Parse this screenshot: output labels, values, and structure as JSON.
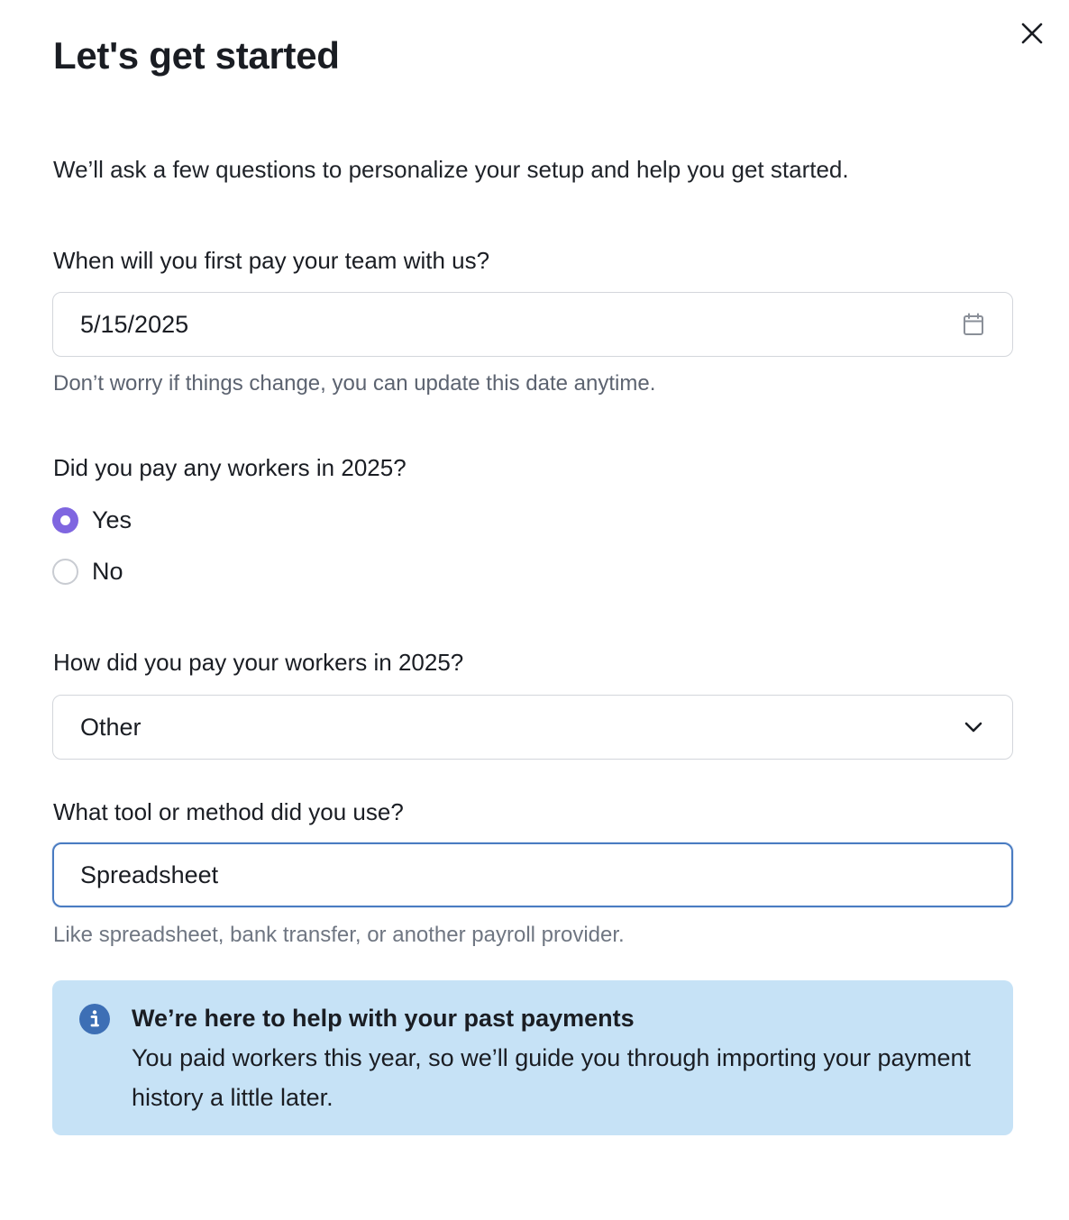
{
  "dialog": {
    "title": "Let's get started",
    "intro": "We’ll ask a few questions to personalize your setup and help you get started.",
    "close_icon": "close-icon"
  },
  "first_pay_date": {
    "label": "When will you first pay your team with us?",
    "value": "5/15/2025",
    "icon": "calendar-icon",
    "hint": "Don’t worry if things change, you can update this date anytime."
  },
  "paid_workers": {
    "label": "Did you pay any workers in 2025?",
    "options": [
      {
        "label": "Yes",
        "checked": true
      },
      {
        "label": "No",
        "checked": false
      }
    ]
  },
  "pay_method": {
    "label": "How did you pay your workers in 2025?",
    "selected": "Other",
    "icon": "chevron-down-icon"
  },
  "tool_method": {
    "label": "What tool or method did you use?",
    "value": "Spreadsheet",
    "hint": "Like spreadsheet, bank transfer, or another payroll provider."
  },
  "info_alert": {
    "icon": "info-icon",
    "title": "We’re here to help with your past payments",
    "body": "You paid workers this year, so we’ll guide you through importing your payment history a little later."
  },
  "colors": {
    "accent_purple": "#7f66e0",
    "focus_blue": "#4a7cc2",
    "alert_bg": "#c6e2f6",
    "info_icon": "#3d6fb5"
  }
}
